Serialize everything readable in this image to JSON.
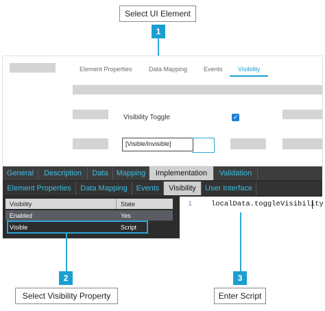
{
  "callouts": {
    "select_ui_element": {
      "label": "Select UI Element",
      "number": "1"
    },
    "select_visibility_property": {
      "label": "Select Visibility Property",
      "number": "2"
    },
    "enter_script": {
      "label": "Enter Script",
      "number": "3"
    }
  },
  "top_panel": {
    "tabs": [
      "Element Properties",
      "Data Mapping",
      "Events",
      "Visibility"
    ],
    "active_tab": "Visibility",
    "field_label": "Visibility Toggle",
    "checkbox_checked": true,
    "value_text": "[Visible/Invisible]",
    "accent_color": "#1a9fd0"
  },
  "designer": {
    "tabs_row1": [
      "General",
      "Description",
      "Data",
      "Mapping",
      "Implementation",
      "Validation"
    ],
    "tabs_row1_active": "Implementation",
    "tabs_row2": [
      "Element Properties",
      "Data Mapping",
      "Events",
      "Visibility",
      "User Interface"
    ],
    "tabs_row2_active": "Visibility",
    "table": {
      "headers": [
        "Visibility",
        "State"
      ],
      "rows": [
        [
          "Enabled",
          "Yes"
        ],
        [
          "Visible",
          "Script"
        ]
      ]
    },
    "editor": {
      "line_number": "1",
      "code": "localData.toggleVisibility;"
    }
  }
}
